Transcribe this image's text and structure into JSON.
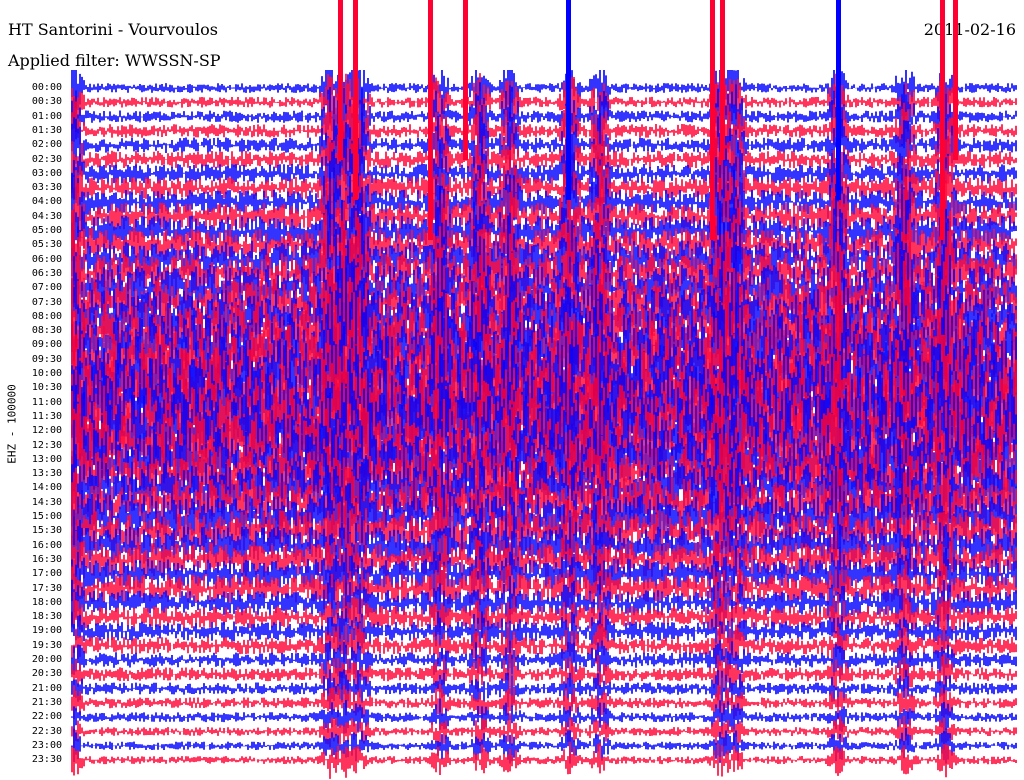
{
  "header": {
    "station": "HT Santorini - Vourvoulos",
    "filter": "Applied filter: WWSSN-SP",
    "date": "2011-02-16"
  },
  "chart_data": {
    "type": "line",
    "title": "HT Santorini - Vourvoulos",
    "subtitle": "Applied filter: WWSSN-SP",
    "ylabel": "EHZ - 100000",
    "xlabel": "",
    "grid": false,
    "colors": [
      "#0000ff",
      "#ff0033"
    ],
    "row_labels": [
      "00:00",
      "00:30",
      "01:00",
      "01:30",
      "02:00",
      "02:30",
      "03:00",
      "03:30",
      "04:00",
      "04:30",
      "05:00",
      "05:30",
      "06:00",
      "06:30",
      "07:00",
      "07:30",
      "08:00",
      "08:30",
      "09:00",
      "09:30",
      "10:00",
      "10:30",
      "11:00",
      "11:30",
      "12:00",
      "12:30",
      "13:00",
      "13:30",
      "14:00",
      "14:30",
      "15:00",
      "15:30",
      "16:00",
      "16:30",
      "17:00",
      "17:30",
      "18:00",
      "18:30",
      "19:00",
      "19:30",
      "20:00",
      "20:30",
      "21:00",
      "21:30",
      "22:00",
      "22:30",
      "23:00",
      "23:30"
    ],
    "traces_note": "Helicorder: 48 half-hour traces alternating blue/red, with dense noise increasing toward the middle of the day."
  }
}
